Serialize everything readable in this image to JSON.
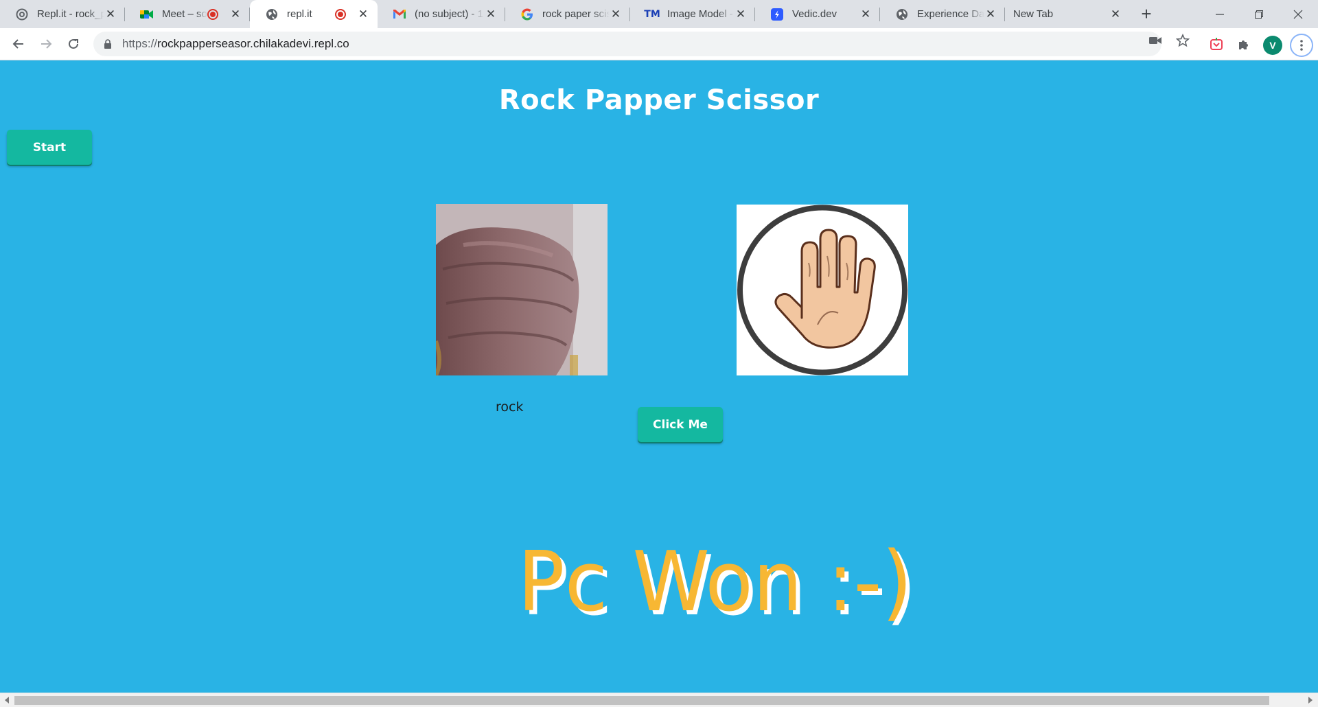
{
  "browser": {
    "tabs": [
      {
        "title": "Repl.it - rock_p",
        "favicon": "replit-icon",
        "recording": false,
        "active": false
      },
      {
        "title": "Meet – soz",
        "favicon": "google-meet-icon",
        "recording": true,
        "active": false
      },
      {
        "title": "repl.it",
        "favicon": "globe-icon",
        "recording": true,
        "active": true
      },
      {
        "title": "(no subject) - 1",
        "favicon": "gmail-icon",
        "recording": false,
        "active": false
      },
      {
        "title": "rock paper scis",
        "favicon": "google-icon",
        "recording": false,
        "active": false
      },
      {
        "title": "Image Model -",
        "favicon": "teachable-machine-icon",
        "recording": false,
        "active": false
      },
      {
        "title": "Vedic.dev",
        "favicon": "vedic-icon",
        "recording": false,
        "active": false
      },
      {
        "title": "Experience Dat",
        "favicon": "globe-icon",
        "recording": false,
        "active": false
      },
      {
        "title": "New Tab",
        "favicon": "",
        "recording": false,
        "active": false
      }
    ],
    "url_prefix": "https://",
    "url_host": "rockpapperseasor.chilakadevi.repl.co",
    "avatar_letter": "V"
  },
  "page": {
    "title": "Rock Papper Scissor",
    "start_label": "Start",
    "click_label": "Click Me",
    "prediction": "rock",
    "result": "Pc Won :-)",
    "pc_choice": "paper"
  },
  "colors": {
    "background": "#29b3e5",
    "button": "#14b8a0",
    "result_text": "#f7b733",
    "result_shadow": "#ffffff"
  }
}
